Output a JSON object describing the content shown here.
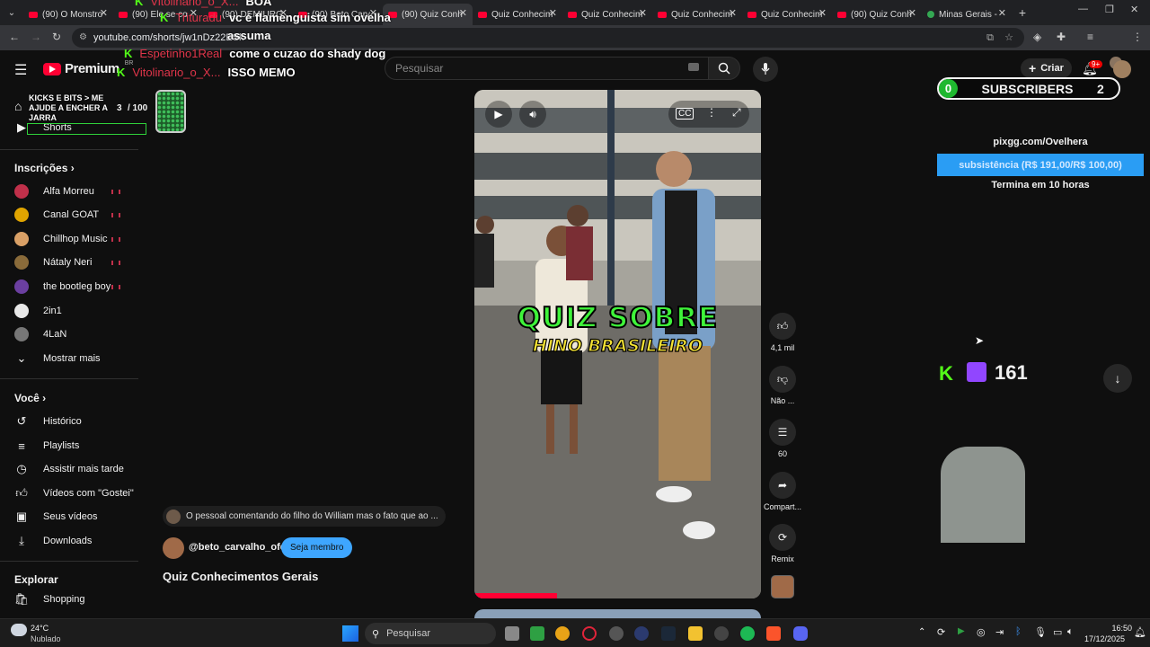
{
  "browser": {
    "tabs": [
      {
        "title": "(90) O Monstro"
      },
      {
        "title": "(90) Ele se co"
      },
      {
        "title": "(90) DEMIURG"
      },
      {
        "title": "(90) Beto Carv"
      },
      {
        "title": "(90) Quiz Conh"
      },
      {
        "title": "Quiz Conhecim"
      },
      {
        "title": "Quiz Conhecim"
      },
      {
        "title": "Quiz Conhecim"
      },
      {
        "title": "Quiz Conhecim"
      },
      {
        "title": "(90) Quiz Conh"
      },
      {
        "title": "Minas Gerais -"
      }
    ],
    "url": "youtube.com/shorts/jw1nDz22ESk"
  },
  "chat": [
    {
      "user": "Vitolinario_o_X...",
      "msg": "BOA"
    },
    {
      "user": "Trituradu",
      "msg": "vc é flamenguista sim ovelha"
    },
    {
      "user": "",
      "msg": "assuma"
    },
    {
      "user": "Espetinho1Real",
      "msg": "come o cuzao do shady dog"
    },
    {
      "user": "Vitolinario_o_X...",
      "msg": "ISSO MEMO"
    }
  ],
  "header": {
    "logo": "Premium",
    "region": "BR",
    "search_placeholder": "Pesquisar",
    "create_label": "Criar",
    "notif_badge": "9+"
  },
  "kicks": {
    "title": "KICKS E BITS > ME AJUDE A ENCHER A JARRA",
    "current": "3",
    "goal": "/ 100"
  },
  "sidebar": {
    "top_items": [
      {
        "label": "Shorts"
      }
    ],
    "subs_heading": "Inscrições",
    "subs": [
      {
        "label": "Alfa Morreu",
        "color": "#c0304a",
        "live": true
      },
      {
        "label": "Canal GOAT",
        "color": "#e0a400",
        "live": true
      },
      {
        "label": "Chillhop Music",
        "color": "#d9a066",
        "live": true
      },
      {
        "label": "Nátaly Neri",
        "color": "#8a6b3a",
        "live": true
      },
      {
        "label": "the bootleg boy",
        "color": "#6b3fa0",
        "live": true
      },
      {
        "label": "2in1",
        "color": "#e8e8e8",
        "live": false
      },
      {
        "label": "4LaN",
        "color": "#777777",
        "live": false
      },
      {
        "label": "Mostrar mais",
        "color": "",
        "live": false
      }
    ],
    "you_heading": "Você",
    "you": [
      {
        "label": "Histórico"
      },
      {
        "label": "Playlists"
      },
      {
        "label": "Assistir mais tarde"
      },
      {
        "label": "Vídeos com \"Gostei\""
      },
      {
        "label": "Seus vídeos"
      },
      {
        "label": "Downloads"
      }
    ],
    "explore_heading": "Explorar",
    "explore": [
      {
        "label": "Shopping"
      }
    ]
  },
  "short": {
    "overlay_line1": "QUIZ SOBRE",
    "overlay_line2": "HINO BRASILEIRO",
    "comment_preview": "O pessoal comentando do filho do William mas o fato que ao ...",
    "channel": "@beto_carvalho_ofc",
    "join_label": "Seja membro",
    "title": "Quiz Conhecimentos Gerais",
    "progress": 0.28
  },
  "actions": {
    "likes": "4,1 mil",
    "dislike": "Não ...",
    "comments": "60",
    "share": "Compart...",
    "remix": "Remix"
  },
  "stream_overlay": {
    "subs_left": "0",
    "subs_label": "SUBSCRIBERS",
    "subs_right": "2",
    "pix_url": "pixgg.com/Ovelhera",
    "goal_text": "subsistência (R$ 191,00/R$ 100,00)",
    "goal_end": "Termina em 10 horas",
    "viewers": "161"
  },
  "taskbar": {
    "weather_temp": "24°C",
    "weather_desc": "Nublado",
    "search_label": "Pesquisar",
    "time": "16:50",
    "date": "17/12/2025"
  }
}
